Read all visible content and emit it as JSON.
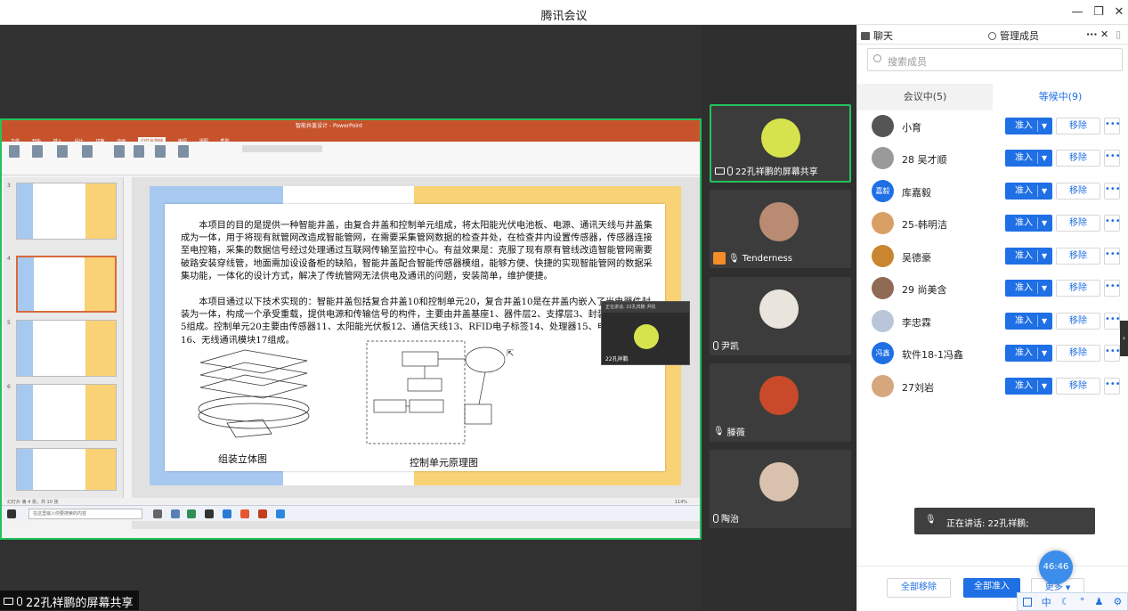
{
  "window": {
    "title": "腾讯会议"
  },
  "share": {
    "badge_label": "22孔祥鹏的屏幕共享",
    "ppt_title": "智能井盖设计 - PowerPoint",
    "ppt_tabs": [
      "文件",
      "开始",
      "插入",
      "设计",
      "切换",
      "动画",
      "幻灯片放映",
      "审阅",
      "视图",
      "帮助"
    ],
    "ppt_status": "幻灯片 第 4 张，共 10 张",
    "ppt_zoom": "114%",
    "taskbar_search": "在这里输入你要搜索的内容",
    "slide": {
      "para1": "本项目的目的是提供一种智能井盖，由复合井盖和控制单元组成，将太阳能光伏电池板、电源、通讯天线与井盖集成为一体，用于将现有就管网改造成智能管网，在需要采集管网数据的检查井处，在检查井内设置传感器，传感器连接至电控箱，采集的数据信号经过处理通过互联网传输至监控中心。有益效果是：克服了现有原有管线改造智能管网需要破路安装穿线管，地面需加设设备柜的缺陷，智能井盖配合智能传感器模组，能够方便、快捷的实现智能管网的数据采集功能，一体化的设计方式，解决了传统管网无法供电及通讯的问题，安装简单，维护便捷。",
      "para2": "本项目通过以下技术实现的：智能井盖包括复合井盖10和控制单元20，复合井盖10是在井盖内嵌入了光电器件封装为一体，构成一个承受重载，提供电源和传输信号的构件，主要由井盖基座1、器件层2、支撑层3、封装层4、井圈5组成。控制单元20主要由传感器11、太阳能光伏板12、通信天线13、RFID电子标签14、处理器15、电源管理器16、无线通讯模块17组成。",
      "caption_left": "组装立体图",
      "caption_right": "控制单元原理图"
    },
    "mini_video_label": "22孔祥鹏",
    "mini_video_header": "正在讲话: 22孔祥鹏 尹凯"
  },
  "video_tiles": [
    {
      "name": "22孔祥鹏的屏幕共享",
      "type": "screen",
      "color": "#d7e34c"
    },
    {
      "name": "Tenderness",
      "type": "host",
      "color": "#b98b73"
    },
    {
      "name": "尹凯",
      "type": "mic",
      "color": "#e9e4dc"
    },
    {
      "name": "滕薇",
      "type": "muted",
      "color": "#c94a2a"
    },
    {
      "name": "陶治",
      "type": "mic",
      "color": "#d9c2ad"
    }
  ],
  "panel": {
    "tab_chat": "聊天",
    "tab_members": "管理成员",
    "search_placeholder": "搜索成员",
    "seg_in_meeting": "会议中(5)",
    "seg_waiting": "等候中(9)",
    "admit_label": "准入",
    "remove_label": "移除",
    "more_label": "•••",
    "waiting_members": [
      {
        "name": "小育",
        "avatar_text": "",
        "color": "#555555"
      },
      {
        "name": "28 吴才顺",
        "avatar_text": "",
        "color": "#9a9a9a"
      },
      {
        "name": "库嘉毅",
        "avatar_text": "嘉毅",
        "color": "#1f6fe5"
      },
      {
        "name": "25-韩明洁",
        "avatar_text": "",
        "color": "#d9a066"
      },
      {
        "name": "吴德豪",
        "avatar_text": "",
        "color": "#c9852f"
      },
      {
        "name": "29 尚美含",
        "avatar_text": "",
        "color": "#8f6a55"
      },
      {
        "name": "李忠霖",
        "avatar_text": "",
        "color": "#b9c6d9"
      },
      {
        "name": "软件18-1冯鑫",
        "avatar_text": "冯鑫",
        "color": "#1f6fe5"
      },
      {
        "name": "27刘岩",
        "avatar_text": "",
        "color": "#d6a67c"
      }
    ],
    "speaking_toast": "正在讲话: 22孔祥鹏;",
    "btn_remove_all": "全部移除",
    "btn_admit_all": "全部准入",
    "btn_more": "更多",
    "timer": "46:46",
    "tray_items": [
      "中",
      "☾",
      "°",
      "♟",
      "⚙"
    ]
  }
}
